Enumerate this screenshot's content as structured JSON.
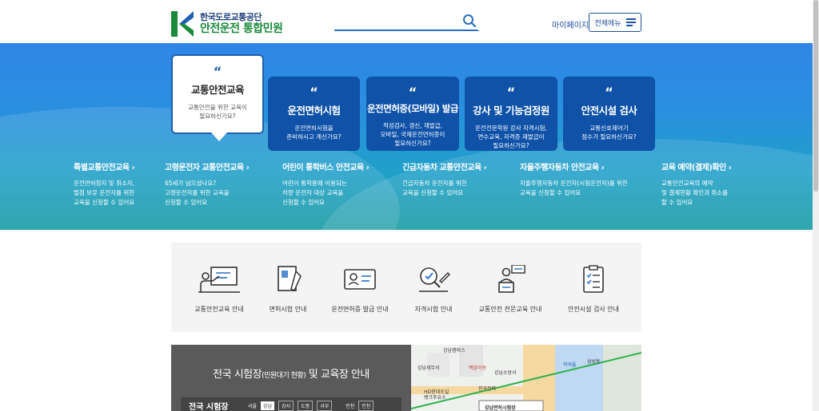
{
  "header": {
    "logo_small": "한국도로교통공단",
    "logo_big": "안전운전 통합민원",
    "search_placeholder": "",
    "mypage": "마이페이지",
    "menu_label": "전체메뉴"
  },
  "hero": {
    "cards": [
      {
        "title": "교통안전교육",
        "desc1": "교통안전을 위한 교육이",
        "desc2": "필요하신가요?"
      },
      {
        "title": "운전면허시험",
        "desc1": "운전면허시험을",
        "desc2": "준비하시고 계신가요?"
      },
      {
        "title": "운전면허증(모바일) 발급",
        "desc1": "적성검사, 갱신, 재발급,",
        "desc2": "모바일, 국제운전면허증이",
        "desc3": "필요하신가요?"
      },
      {
        "title": "강사 및 기능검정원",
        "desc1": "운전전문학원 강사 자격시험,",
        "desc2": "연수교육, 자격증 재발급이",
        "desc3": "필요하신가요?"
      },
      {
        "title": "안전시설 검사",
        "desc1": "교통신호제어기",
        "desc2": "점수가 필요하신가요?"
      }
    ],
    "links": [
      {
        "title": "특별교통안전교육",
        "d1": "운전면허정지 및 취소자,",
        "d2": "벌점 보유 운전자를 위한",
        "d3": "교육을 신청할 수 있어요"
      },
      {
        "title": "고령운전자 교통안전교육",
        "d1": "65세가 넘으셨나요?",
        "d2": "고령운전자를 위한 교육을",
        "d3": "신청할 수 있어요"
      },
      {
        "title": "어린이 통학버스 안전교육",
        "d1": "어린이 통학용에 이용되는",
        "d2": "차량 운전자 대상 교육을",
        "d3": "신청할 수 있어요"
      },
      {
        "title": "긴급자동차 교통안전교육",
        "d1": "긴급자동차 운전자를 위한",
        "d2": "교육을 신청할 수 있어요",
        "d3": ""
      },
      {
        "title": "자율주행자동차 안전교육",
        "d1": "자율주행자동차 운전자(시험운전자)를 위한",
        "d2": "교육을 신청할 수 있어요",
        "d3": ""
      },
      {
        "title": "교육 예약(결제)확인",
        "d1": "교통안전교육의 예약",
        "d2": "및 결제현황 확인과 취소를",
        "d3": "할 수 있어요"
      }
    ]
  },
  "quick_menu": [
    {
      "label": "교통안전교육 안내",
      "icon": "presentation-icon"
    },
    {
      "label": "면허시험 안내",
      "icon": "license-book-icon"
    },
    {
      "label": "운전면허증 발급 안내",
      "icon": "id-card-icon"
    },
    {
      "label": "자격시험 안내",
      "icon": "exam-pen-icon"
    },
    {
      "label": "교통안전 전문교육 안내",
      "icon": "lecturer-icon"
    },
    {
      "label": "안전시설 검사 안내",
      "icon": "checklist-icon"
    }
  ],
  "exam": {
    "title_main": "전국 시험장",
    "title_small": "(민원대기 현황)",
    "title_rest": " 및 교육장 안내",
    "row_label": "전국 시험장",
    "regions": [
      "서울",
      "강남",
      "강서",
      "도봉",
      "서부",
      "인천",
      "인천"
    ]
  },
  "map": {
    "labels": [
      "강남캠퍼스",
      "강남면허시험장",
      "강남소방서",
      "백암이동",
      "HD현대오일",
      "뱅크주유소",
      "학여울",
      "삼성동",
      "강남세무서",
      "한국전력"
    ]
  },
  "colors": {
    "primary": "#1f5fb0",
    "green": "#1a8a3c",
    "card": "#0f52a8"
  }
}
